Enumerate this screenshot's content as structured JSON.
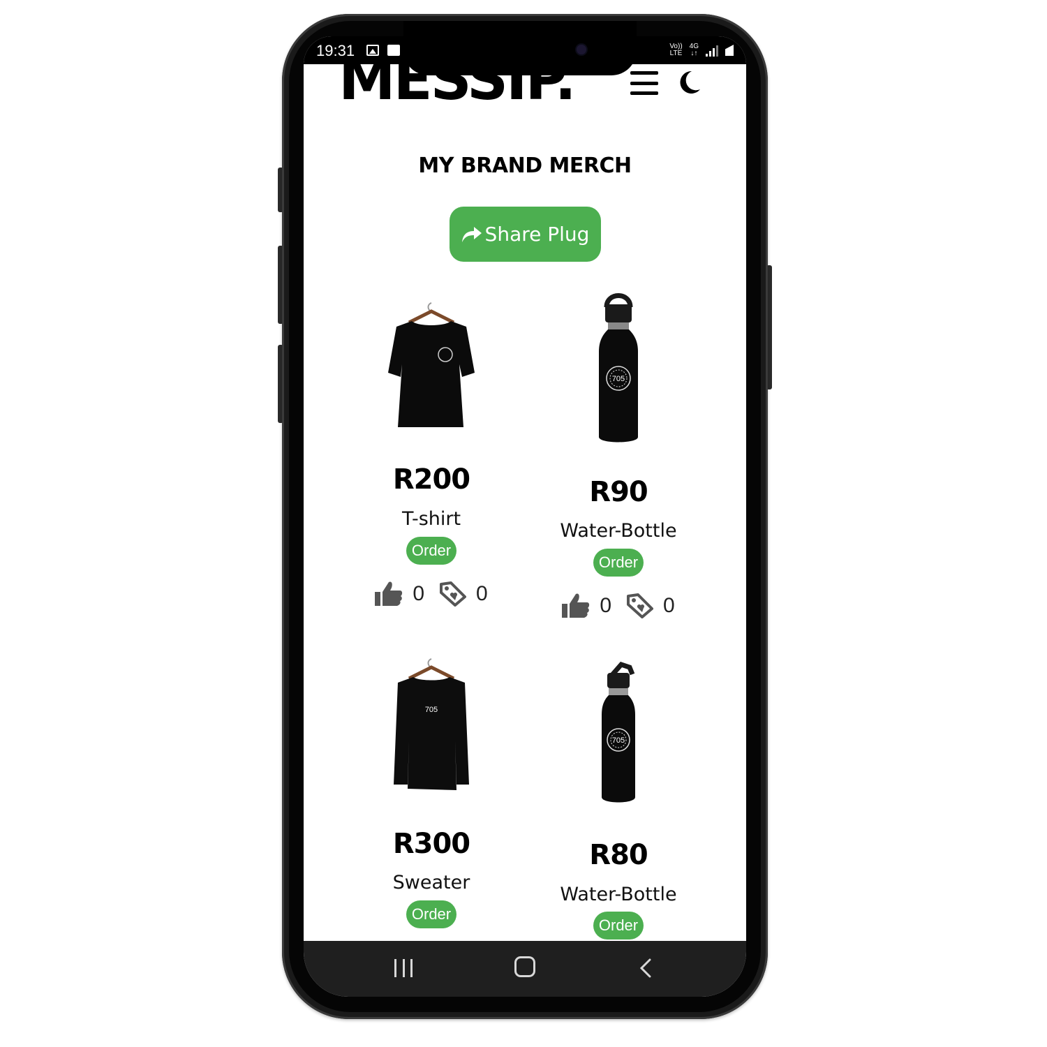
{
  "status_bar": {
    "time": "19:31",
    "network_top": "Vo))",
    "network_bottom": "LTE",
    "data_top": "4G",
    "data_bottom": "↓↑"
  },
  "header": {
    "logo": "MESSIP.",
    "menu_icon": "hamburger-menu-icon",
    "theme_icon": "moon-icon"
  },
  "page": {
    "title": "MY BRAND MERCH",
    "share_label": "Share Plug",
    "share_icon": "share-arrow-icon"
  },
  "products": [
    {
      "image": "black-tshirt-image",
      "price": "R200",
      "name": "T-shirt",
      "order_label": "Order",
      "likes": "0",
      "tags": "0"
    },
    {
      "image": "black-water-bottle-image",
      "price": "R90",
      "name": "Water-Bottle",
      "order_label": "Order",
      "likes": "0",
      "tags": "0"
    },
    {
      "image": "black-sweater-image",
      "price": "R300",
      "name": "Sweater",
      "order_label": "Order"
    },
    {
      "image": "black-sport-bottle-image",
      "price": "R80",
      "name": "Water-Bottle",
      "order_label": "Order"
    }
  ],
  "product_print": "705",
  "colors": {
    "accent_green": "#4caf50",
    "text": "#000000",
    "nav_bar": "#1f1f1f"
  }
}
